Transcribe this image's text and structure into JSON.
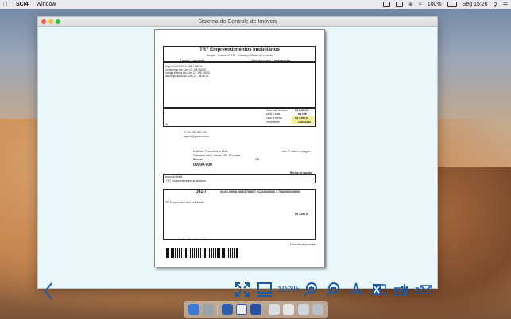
{
  "menubar": {
    "app_name": "SCI4",
    "menu_window": "Window",
    "battery": "100%",
    "clock": "Seg 15:26"
  },
  "window": {
    "title": "Sistema de Controle de Imóveis"
  },
  "document": {
    "company": "TR7 Empreendimentos Imobiliários",
    "subtitle": "Aluguel - Controle Nº 123 - Cobrança / Recibo de Locação",
    "fatura_label": "Fatura nº",
    "fatura_value": "000.037",
    "emissao_label": "Data de emissão",
    "emissao_value": "09/09/2019",
    "items": [
      "Aluguel 04/07/2019 - R$ 1.450,00",
      "Condomínio Ato Conj 10 - R$ 550,00",
      "Energia elétrica Ato Conj 10 - R$ 130,00",
      "Taxa segurança Ato Conj 10 - R$ 80,01"
    ],
    "vlr_total_label": "Valor total do título",
    "vlr_total": "R$ 2.499,01",
    "desconto_label": "Desc. / Abat.",
    "desconto": "R$ 0,00",
    "vlr_cobrar_label": "Valor a cobrar",
    "vlr_cobrar": "R$ 2.499,01",
    "vencimento_label": "Vencimento",
    "vencimento": "15/08/2019",
    "nf": "Nf",
    "cnpj": "07.261.291/0001-26",
    "email": "suporte@gmail.com.br",
    "sacado": "NatSan Consultoria Ltda",
    "endereco": "Calçada das Laurás 192 3º andar",
    "bairro": "Barueri",
    "uf": "SP",
    "aos_cuidados": "a/c: Contas a pagar",
    "cep": "00000-000",
    "recibo_sacado": "Recibo do sacado",
    "banco_name": "Banco do Brasil",
    "codigo_banco": "341-7",
    "linha_digitavel": "34191.09008 00063.794007 01234.060006 1 79820000249901",
    "cedente": "TR7 Empreendimentos Imobiliários",
    "valor_doc": "R$ 2.499,01",
    "ficha_compensacao": "Ficha de compensação"
  },
  "toolbar": {
    "zoom_label": "100%"
  },
  "colors": {
    "accent": "#1d5aa6",
    "highlight": "#f5f19a"
  }
}
